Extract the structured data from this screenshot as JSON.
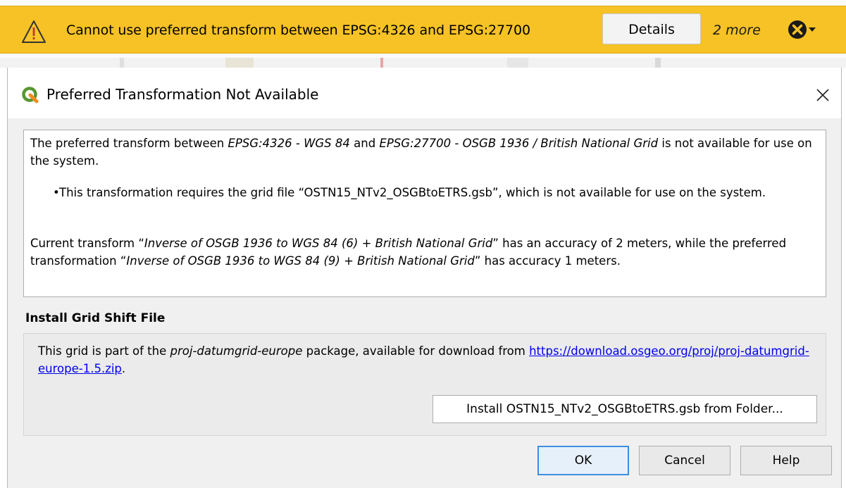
{
  "message_bar": {
    "text": "Cannot use preferred transform between EPSG:4326 and EPSG:27700",
    "details_label": "Details",
    "more_label": "2 more",
    "icons": {
      "warning": "warning-triangle-icon",
      "close": "close-circle-icon",
      "dropdown": "chevron-down-icon"
    },
    "colors": {
      "background": "#f6c225"
    }
  },
  "dialog": {
    "title": "Preferred Transformation Not Available",
    "icons": {
      "app": "qgis-logo-icon",
      "close": "close-icon"
    },
    "message": {
      "p1_a": "The preferred transform between ",
      "p1_src": "EPSG:4326 - WGS 84",
      "p1_b": " and ",
      "p1_dst": "EPSG:27700 - OSGB 1936 / British National Grid",
      "p1_c": " is not available for use on the system.",
      "bullet": "•",
      "p2": "This transformation requires the grid file “OSTN15_NTv2_OSGBtoETRS.gsb”, which is not available for use on the system.",
      "p3_a": "Current transform “",
      "p3_current": "Inverse of OSGB 1936 to WGS 84 (6) + British National Grid",
      "p3_b": "” has an accuracy of 2 meters, while the preferred transformation “",
      "p3_preferred": "Inverse of OSGB 1936 to WGS 84 (9) + British National Grid",
      "p3_c": "” has accuracy 1 meters."
    },
    "grid_section": {
      "label": "Install Grid Shift File",
      "text_a": "This grid is part of the ",
      "package": "proj-datumgrid-europe",
      "text_b": " package, available for download from ",
      "link": "https://download.osgeo.org/proj/proj-datumgrid-europe-1.5.zip",
      "text_c": ".",
      "install_button": "Install OSTN15_NTv2_OSGBtoETRS.gsb from Folder..."
    },
    "buttons": {
      "ok": "OK",
      "cancel": "Cancel",
      "help": "Help"
    }
  }
}
